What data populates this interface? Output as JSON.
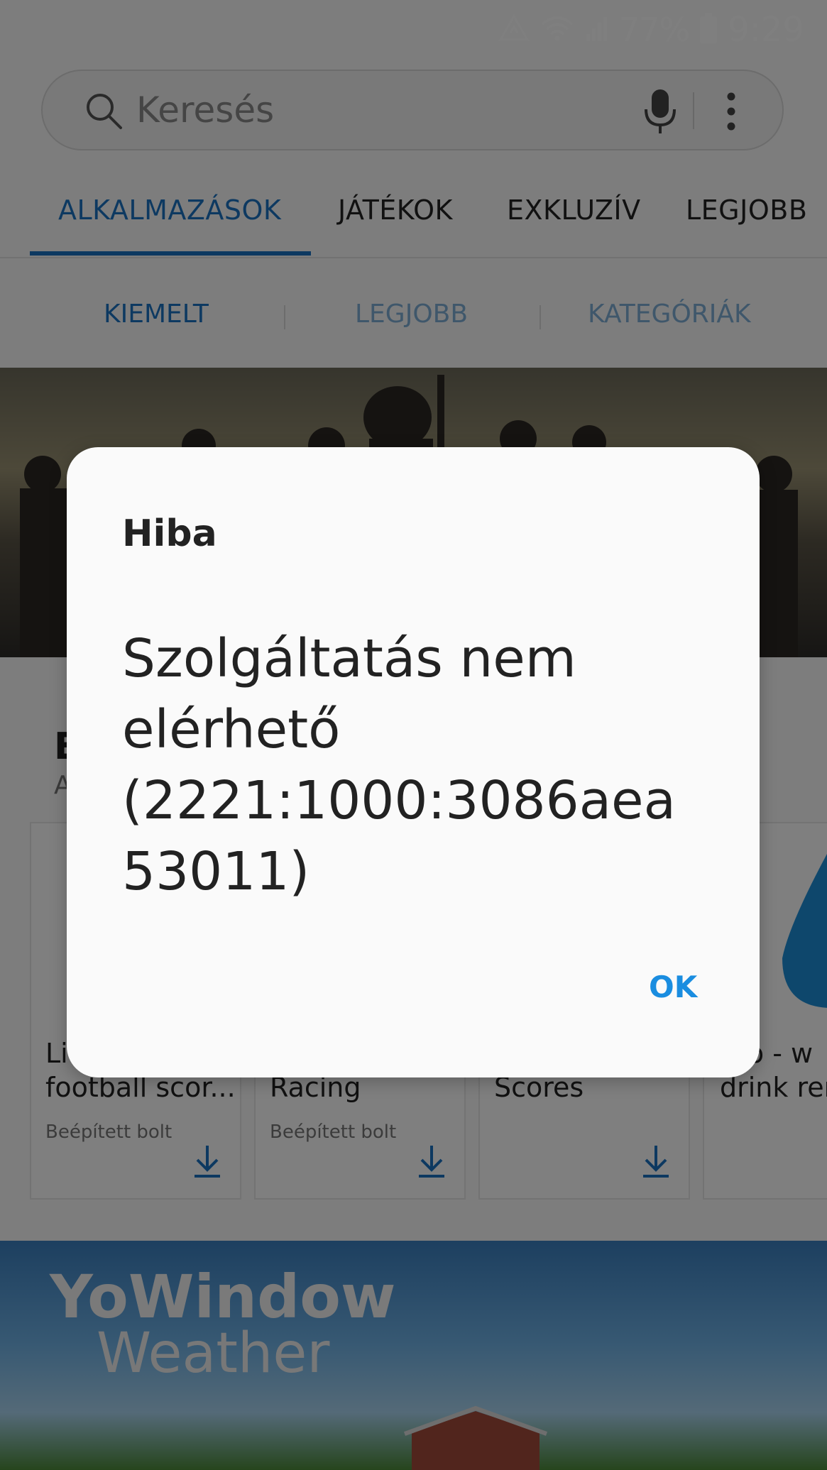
{
  "status_bar": {
    "battery_percent": "77%",
    "time": "9:29"
  },
  "search": {
    "placeholder": "Keresés"
  },
  "tabs": [
    {
      "label": "ALKALMAZÁSOK"
    },
    {
      "label": "JÁTÉKOK"
    },
    {
      "label": "EXKLUZÍV"
    },
    {
      "label": "LEGJOBB"
    }
  ],
  "subtabs": [
    {
      "label": "KIEMELT"
    },
    {
      "label": "LEGJOBB"
    },
    {
      "label": "KATEGÓRIÁK"
    }
  ],
  "section": {
    "title_partial": "E",
    "subtitle_partial": "A"
  },
  "cards": [
    {
      "title": "Li\nfootball scor...",
      "seller": "Beépített bolt"
    },
    {
      "title": "\nRacing",
      "seller": "Beépített bolt"
    },
    {
      "title": "\nScores",
      "seller": ""
    },
    {
      "title": "dro - w\ndrink rem",
      "seller": ""
    }
  ],
  "banner2": {
    "line1": "YoWindow",
    "line2": "Weather"
  },
  "dialog": {
    "title": "Hiba",
    "message": "Szolgáltatás nem elérhető (2221:1000:3086aea 53011)",
    "ok_label": "OK"
  },
  "colors": {
    "accent": "#1a73c2",
    "ok_button": "#1a8de0"
  }
}
